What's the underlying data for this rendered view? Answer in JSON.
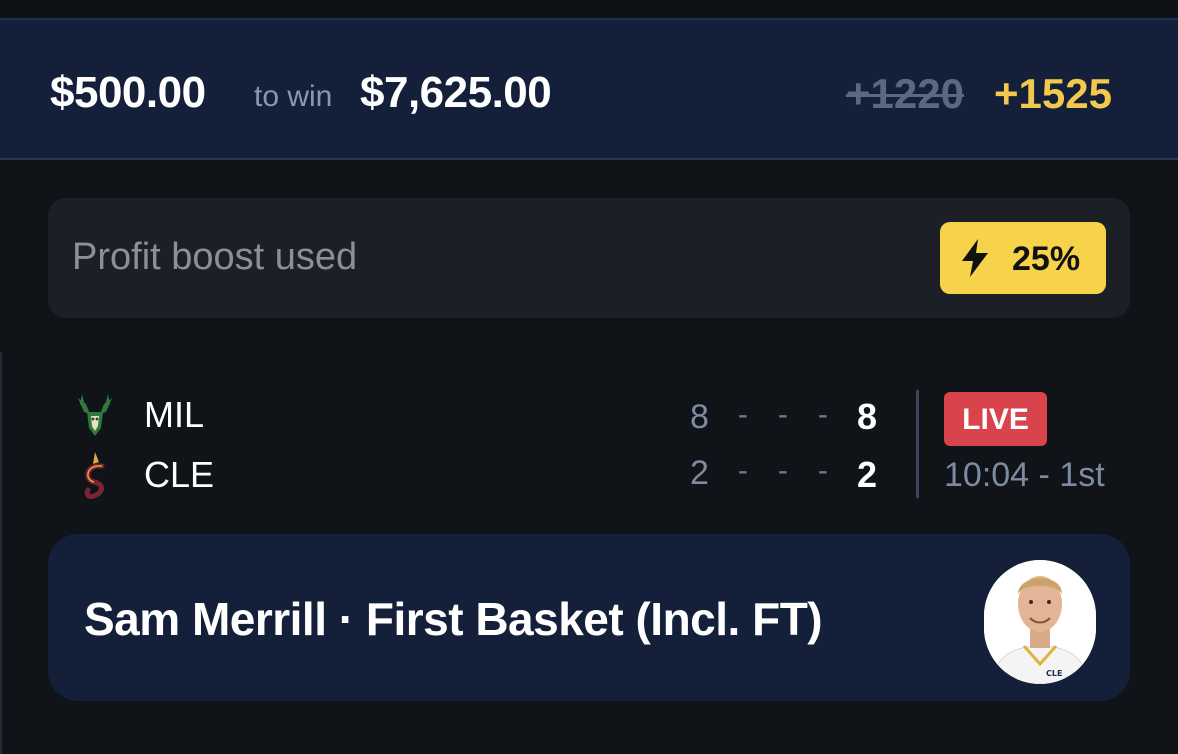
{
  "bet": {
    "stake": "$500.00",
    "to_win_label": "to win",
    "payout": "$7,625.00",
    "original_odds": "+1220",
    "boosted_odds": "+1525"
  },
  "boost": {
    "label": "Profit boost used",
    "percent": "25%",
    "icon": "lightning-bolt-icon",
    "badge_color": "#f6d34a"
  },
  "game": {
    "teams": [
      {
        "abbr": "MIL",
        "quarter_score": "8",
        "total": "8",
        "logo": "bucks-logo"
      },
      {
        "abbr": "CLE",
        "quarter_score": "2",
        "total": "2",
        "logo": "cavaliers-logo"
      }
    ],
    "status_badge": "LIVE",
    "status_color": "#d8434c",
    "clock": "10:04 - 1st"
  },
  "selection": {
    "title": "Sam Merrill · First Basket (Incl. FT)",
    "avatar_icon": "player-headshot"
  },
  "colors": {
    "boost_accent": "#f2c94c",
    "header_bg": "#14203a",
    "page_bg": "#101318"
  }
}
